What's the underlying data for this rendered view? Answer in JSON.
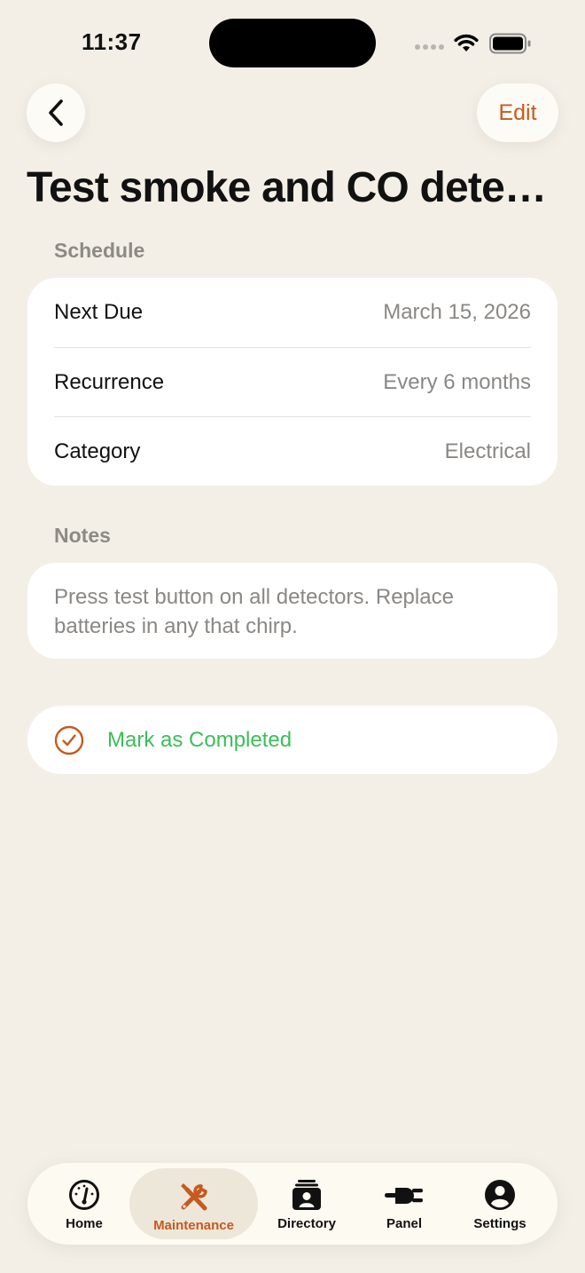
{
  "status_bar": {
    "time": "11:37"
  },
  "nav": {
    "edit_label": "Edit"
  },
  "title": "Test smoke and CO dete…",
  "schedule": {
    "header": "Schedule",
    "rows": [
      {
        "label": "Next Due",
        "value": "March 15, 2026"
      },
      {
        "label": "Recurrence",
        "value": "Every 6 months"
      },
      {
        "label": "Category",
        "value": "Electrical"
      }
    ]
  },
  "notes": {
    "header": "Notes",
    "text": "Press test button on all detectors. Replace batteries in any that chirp."
  },
  "action": {
    "label": "Mark as Completed",
    "icon": "checkmark-circle-icon"
  },
  "tab_bar": {
    "active_index": 1,
    "tabs": [
      {
        "label": "Home",
        "icon": "gauge-icon"
      },
      {
        "label": "Maintenance",
        "icon": "tools-icon"
      },
      {
        "label": "Directory",
        "icon": "contacts-icon"
      },
      {
        "label": "Panel",
        "icon": "plug-icon"
      },
      {
        "label": "Settings",
        "icon": "person-circle-icon"
      }
    ]
  },
  "colors": {
    "background": "#f3efe7",
    "accent": "#c65a1e",
    "success": "#3bbe5a",
    "secondary_text": "#8a8784"
  }
}
